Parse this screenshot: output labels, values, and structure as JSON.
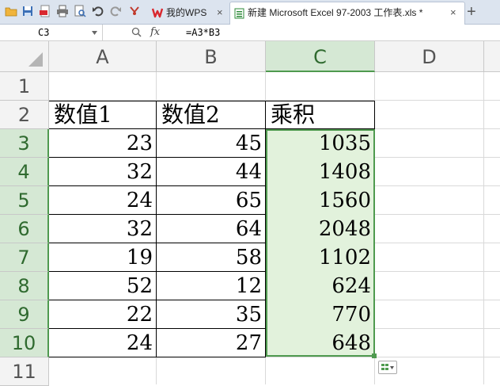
{
  "tabs": {
    "wps_label": "我的WPS",
    "doc_label": "新建 Microsoft Excel 97-2003 工作表.xls *",
    "close_glyph": "×",
    "new_tab_glyph": "+"
  },
  "formula_bar": {
    "cell_ref": "C3",
    "fx_label": "fx",
    "formula": "=A3*B3"
  },
  "columns": [
    "A",
    "B",
    "C",
    "D"
  ],
  "rows": [
    "1",
    "2",
    "3",
    "4",
    "5",
    "6",
    "7",
    "8",
    "9",
    "10",
    "11"
  ],
  "headers": {
    "a": "数值1",
    "b": "数值2",
    "c": "乘积"
  },
  "data_rows": [
    {
      "a": "23",
      "b": "45",
      "c": "1035"
    },
    {
      "a": "32",
      "b": "44",
      "c": "1408"
    },
    {
      "a": "24",
      "b": "65",
      "c": "1560"
    },
    {
      "a": "32",
      "b": "64",
      "c": "2048"
    },
    {
      "a": "19",
      "b": "58",
      "c": "1102"
    },
    {
      "a": "52",
      "b": "12",
      "c": "624"
    },
    {
      "a": "22",
      "b": "35",
      "c": "770"
    },
    {
      "a": "24",
      "b": "27",
      "c": "648"
    }
  ],
  "colors": {
    "selection": "#4f9a4f",
    "selection_fill": "#e2f2dc",
    "wps_red": "#d9282f"
  }
}
